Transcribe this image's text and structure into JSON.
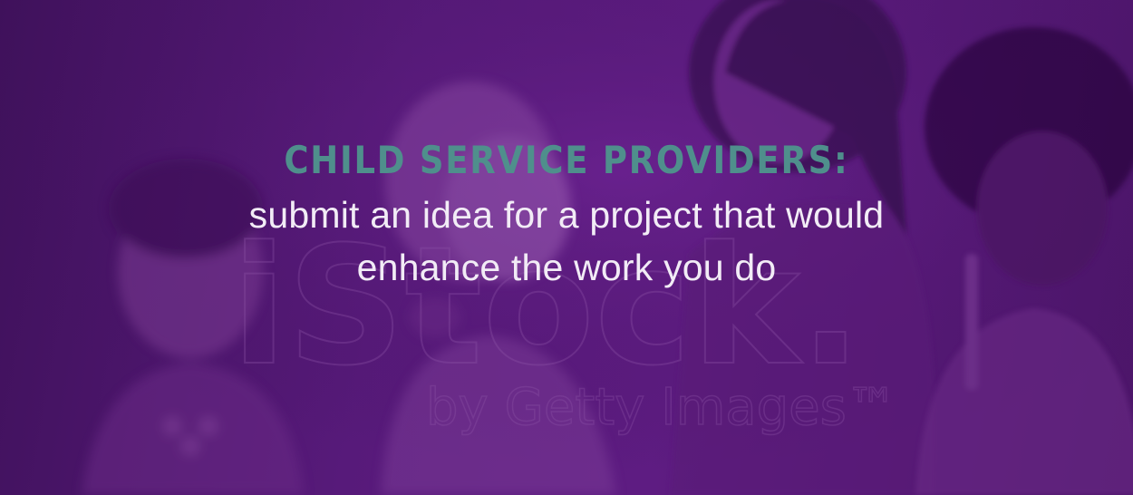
{
  "banner": {
    "headline": "CHILD SERVICE PROVIDERS:",
    "line1": "submit an idea for a project that would",
    "line2": "enhance the work you do",
    "watermark_text": "iStock",
    "watermark_sub": "by Getty Images™"
  },
  "colors": {
    "overlay": "#5e1c82",
    "headline": "#4f8f8c",
    "subline": "#f2ecf6"
  }
}
